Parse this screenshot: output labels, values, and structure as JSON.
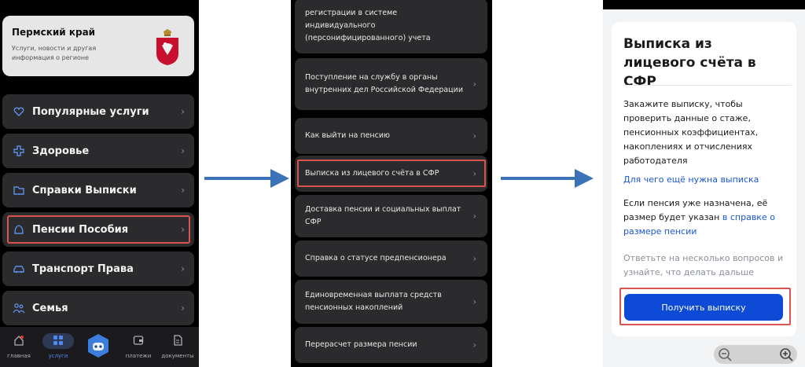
{
  "screen1": {
    "region": {
      "title": "Пермский край",
      "subtitle": "Услуги, новости и другая информация о регионе"
    },
    "menu": [
      {
        "label": "Популярные услуги",
        "icon": "heart-icon"
      },
      {
        "label": "Здоровье",
        "icon": "plus-icon"
      },
      {
        "label": "Справки Выписки",
        "icon": "folder-icon"
      },
      {
        "label": "Пенсии Пособия",
        "icon": "pension-icon"
      },
      {
        "label": "Транспорт Права",
        "icon": "car-icon"
      },
      {
        "label": "Семья",
        "icon": "family-icon"
      }
    ],
    "nav": [
      {
        "label": "главная",
        "icon": "home-icon"
      },
      {
        "label": "услуги",
        "icon": "grid-icon"
      },
      {
        "label": "",
        "icon": "robot-assistant-icon"
      },
      {
        "label": "платежи",
        "icon": "wallet-icon"
      },
      {
        "label": "документы",
        "icon": "document-icon"
      }
    ]
  },
  "screen2": {
    "items": [
      {
        "label": "регистрации в системе индивидуального (персонифицированного) учета"
      },
      {
        "label": "Поступление на службу в органы внутренних дел Российской Федерации"
      },
      {
        "label": "Как выйти на пенсию"
      },
      {
        "label": "Выписка из лицевого счёта в СФР"
      },
      {
        "label": "Доставка пенсии и социальных выплат СФР"
      },
      {
        "label": "Справка о статусе предпенсионера"
      },
      {
        "label": "Единовременная выплата средств пенсионных накоплений"
      },
      {
        "label": "Перерасчет размера пенсии"
      }
    ]
  },
  "screen3": {
    "title": "Выписка из лицевого счёта в СФР",
    "description": "Закажите выписку, чтобы проверить данные о стаже, пенсионных коэффициентах, накоплениях и отчислениях работодателя",
    "why_link": "Для чего ещё нужна выписка",
    "info_prefix": "Если пенсия уже назначена, её размер будет указан",
    "info_link": "в справке о размере пенсии",
    "hint": "Ответьте на несколько вопросов и узнайте, что делать дальше",
    "button": "Получить выписку"
  },
  "colors": {
    "highlight": "#d9534f",
    "arrow": "#3a73b8",
    "primary_button": "#0d4ad6",
    "link": "#1a56d6"
  }
}
